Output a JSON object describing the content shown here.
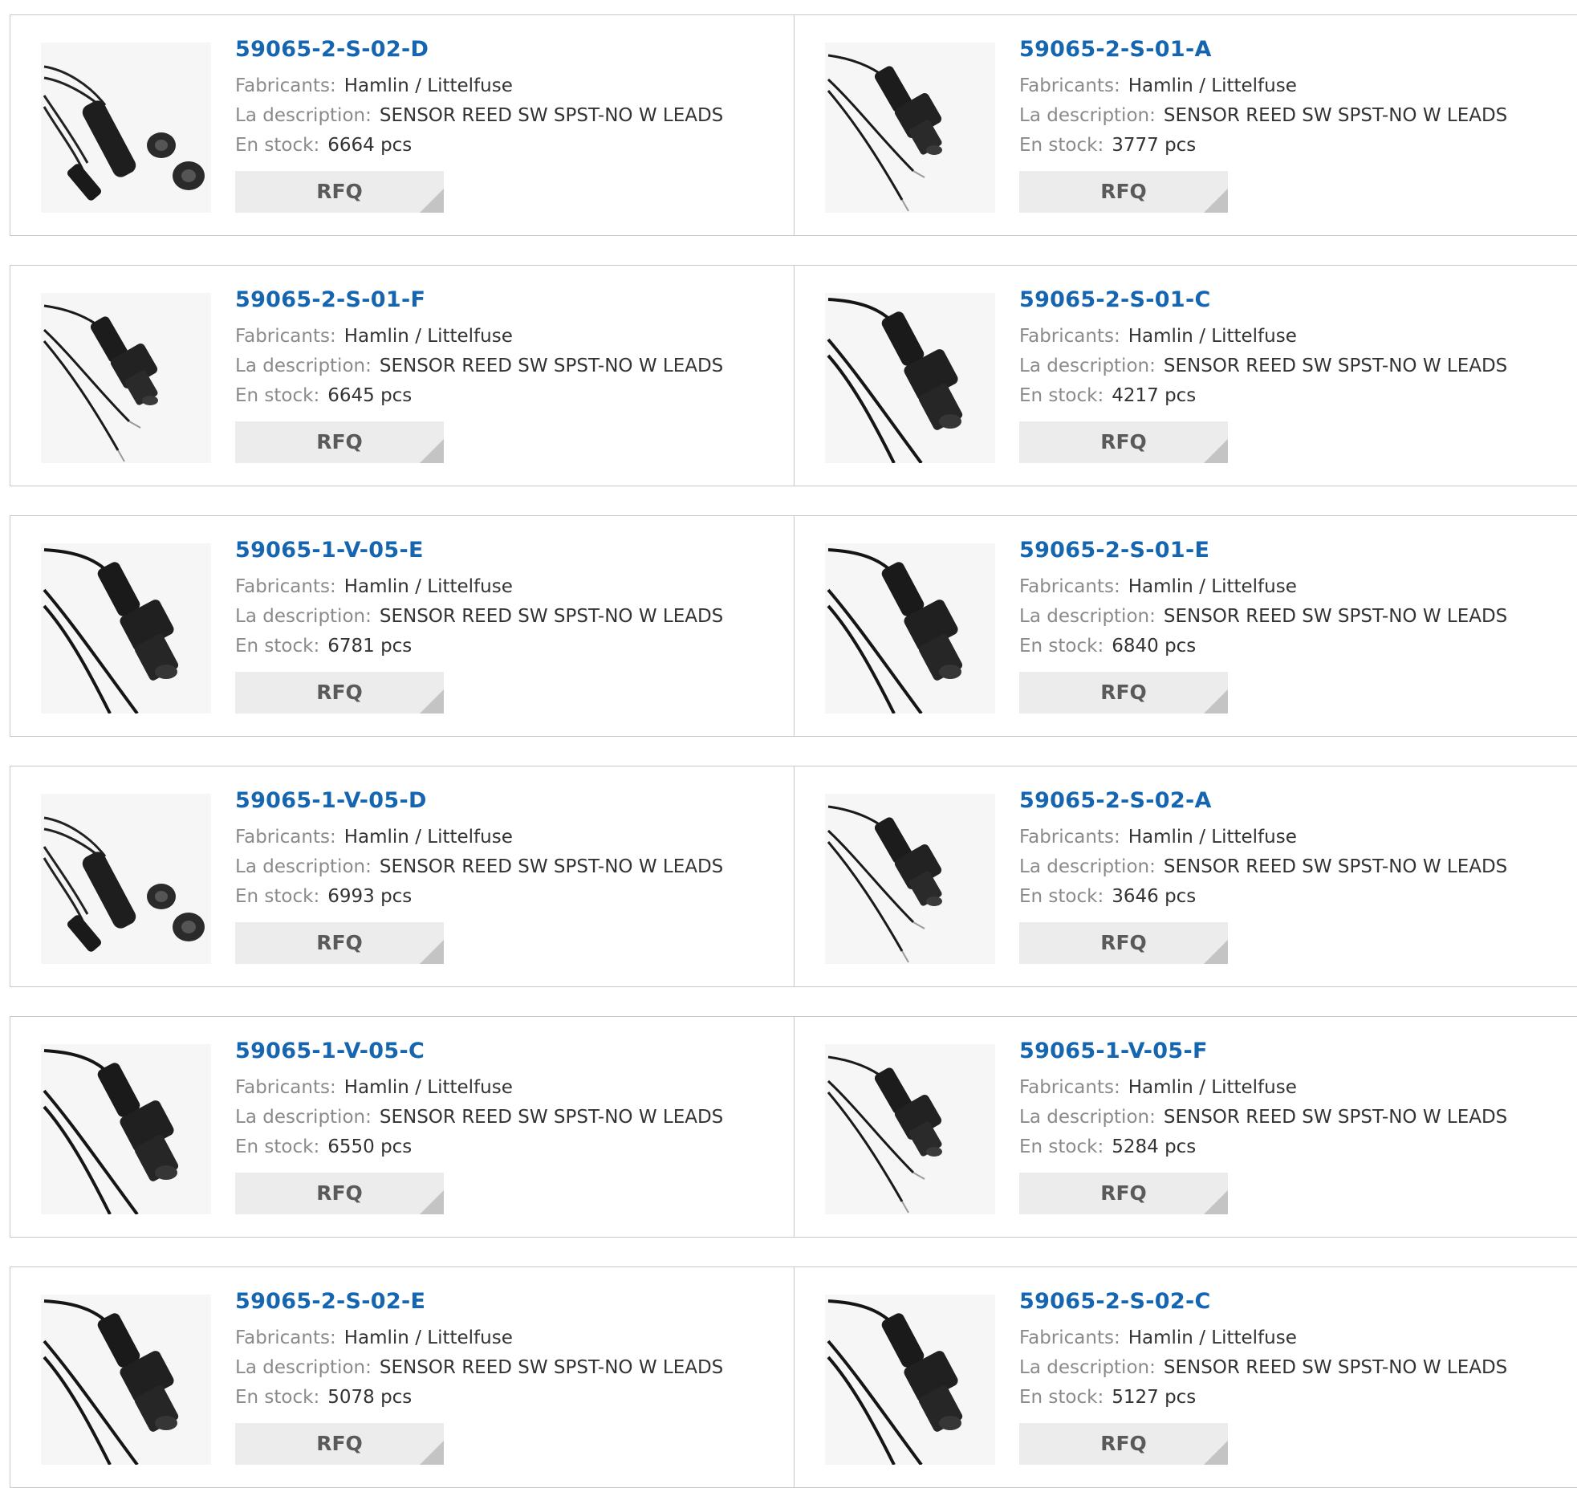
{
  "labels": {
    "manufacturer": "Fabricants:",
    "description": "La description:",
    "stock": "En stock:",
    "rfq": "RFQ"
  },
  "colors": {
    "part_link": "#1565b0",
    "label": "#8a8a8a",
    "value": "#333333",
    "button_bg": "#ececec"
  },
  "products": [
    {
      "part": "59065-2-S-02-D",
      "manufacturer": "Hamlin / Littelfuse",
      "description": "SENSOR REED SW SPST-NO W LEADS",
      "stock": "6664 pcs",
      "image": "reed-sensor-cylinder-with-nuts"
    },
    {
      "part": "59065-2-S-01-A",
      "manufacturer": "Hamlin / Littelfuse",
      "description": "SENSOR REED SW SPST-NO W LEADS",
      "stock": "3777 pcs",
      "image": "reed-sensor-threaded-small"
    },
    {
      "part": "59065-2-S-01-F",
      "manufacturer": "Hamlin / Littelfuse",
      "description": "SENSOR REED SW SPST-NO W LEADS",
      "stock": "6645 pcs",
      "image": "reed-sensor-threaded-small"
    },
    {
      "part": "59065-2-S-01-C",
      "manufacturer": "Hamlin / Littelfuse",
      "description": "SENSOR REED SW SPST-NO W LEADS",
      "stock": "4217 pcs",
      "image": "reed-sensor-threaded-large"
    },
    {
      "part": "59065-1-V-05-E",
      "manufacturer": "Hamlin / Littelfuse",
      "description": "SENSOR REED SW SPST-NO W LEADS",
      "stock": "6781 pcs",
      "image": "reed-sensor-threaded-large"
    },
    {
      "part": "59065-2-S-01-E",
      "manufacturer": "Hamlin / Littelfuse",
      "description": "SENSOR REED SW SPST-NO W LEADS",
      "stock": "6840 pcs",
      "image": "reed-sensor-threaded-large"
    },
    {
      "part": "59065-1-V-05-D",
      "manufacturer": "Hamlin / Littelfuse",
      "description": "SENSOR REED SW SPST-NO W LEADS",
      "stock": "6993 pcs",
      "image": "reed-sensor-cylinder-with-nuts"
    },
    {
      "part": "59065-2-S-02-A",
      "manufacturer": "Hamlin / Littelfuse",
      "description": "SENSOR REED SW SPST-NO W LEADS",
      "stock": "3646 pcs",
      "image": "reed-sensor-threaded-small"
    },
    {
      "part": "59065-1-V-05-C",
      "manufacturer": "Hamlin / Littelfuse",
      "description": "SENSOR REED SW SPST-NO W LEADS",
      "stock": "6550 pcs",
      "image": "reed-sensor-threaded-large"
    },
    {
      "part": "59065-1-V-05-F",
      "manufacturer": "Hamlin / Littelfuse",
      "description": "SENSOR REED SW SPST-NO W LEADS",
      "stock": "5284 pcs",
      "image": "reed-sensor-threaded-small"
    },
    {
      "part": "59065-2-S-02-E",
      "manufacturer": "Hamlin / Littelfuse",
      "description": "SENSOR REED SW SPST-NO W LEADS",
      "stock": "5078 pcs",
      "image": "reed-sensor-threaded-large"
    },
    {
      "part": "59065-2-S-02-C",
      "manufacturer": "Hamlin / Littelfuse",
      "description": "SENSOR REED SW SPST-NO W LEADS",
      "stock": "5127 pcs",
      "image": "reed-sensor-threaded-large"
    }
  ]
}
